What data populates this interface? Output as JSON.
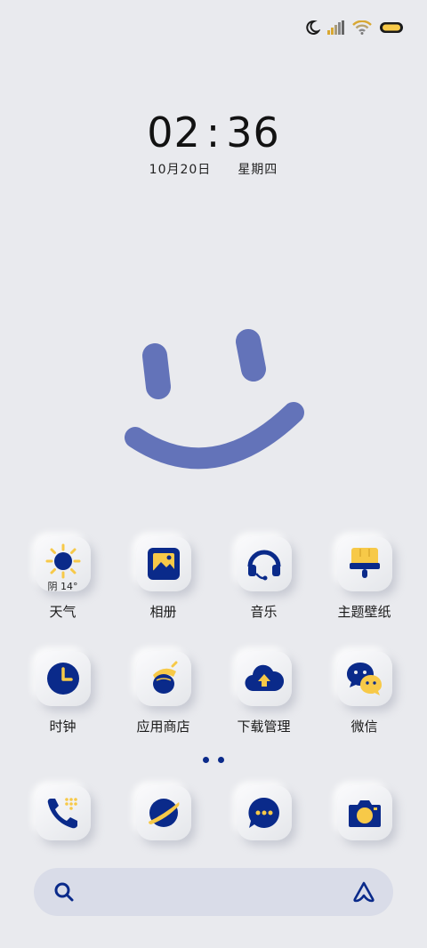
{
  "status_bar": {
    "icons": [
      "moon-icon",
      "signal-icon",
      "wifi-icon",
      "battery-icon"
    ],
    "accent": "#f7c948",
    "ink": "#0a2a8a"
  },
  "clock": {
    "hours": "02",
    "colon": ":",
    "minutes": "36"
  },
  "date": {
    "day": "10月20日",
    "weekday": "星期四"
  },
  "wallpaper": {
    "icon": "smiley-face-icon",
    "color": "#6373b9"
  },
  "apps_row1": [
    {
      "label": "天气",
      "icon": "weather-sun-icon",
      "temp": "阴 14°"
    },
    {
      "label": "相册",
      "icon": "gallery-icon"
    },
    {
      "label": "音乐",
      "icon": "headphones-icon"
    },
    {
      "label": "主题壁纸",
      "icon": "paint-brush-icon"
    }
  ],
  "apps_row2": [
    {
      "label": "时钟",
      "icon": "clock-icon"
    },
    {
      "label": "应用商店",
      "icon": "acorn-icon"
    },
    {
      "label": "下载管理",
      "icon": "cloud-upload-icon"
    },
    {
      "label": "微信",
      "icon": "wechat-icon"
    }
  ],
  "dock": [
    {
      "icon": "phone-icon"
    },
    {
      "icon": "browser-planet-icon"
    },
    {
      "icon": "messages-icon"
    },
    {
      "icon": "camera-icon"
    }
  ],
  "page_indicator": {
    "count": 2,
    "color": "#0a2a8a"
  },
  "search_bar": {
    "left_icon": "search-icon",
    "right_icon": "assistant-icon"
  },
  "colors": {
    "brand_blue": "#0a2a8a",
    "brand_yellow": "#f7c948",
    "background": "#e9eaee"
  }
}
